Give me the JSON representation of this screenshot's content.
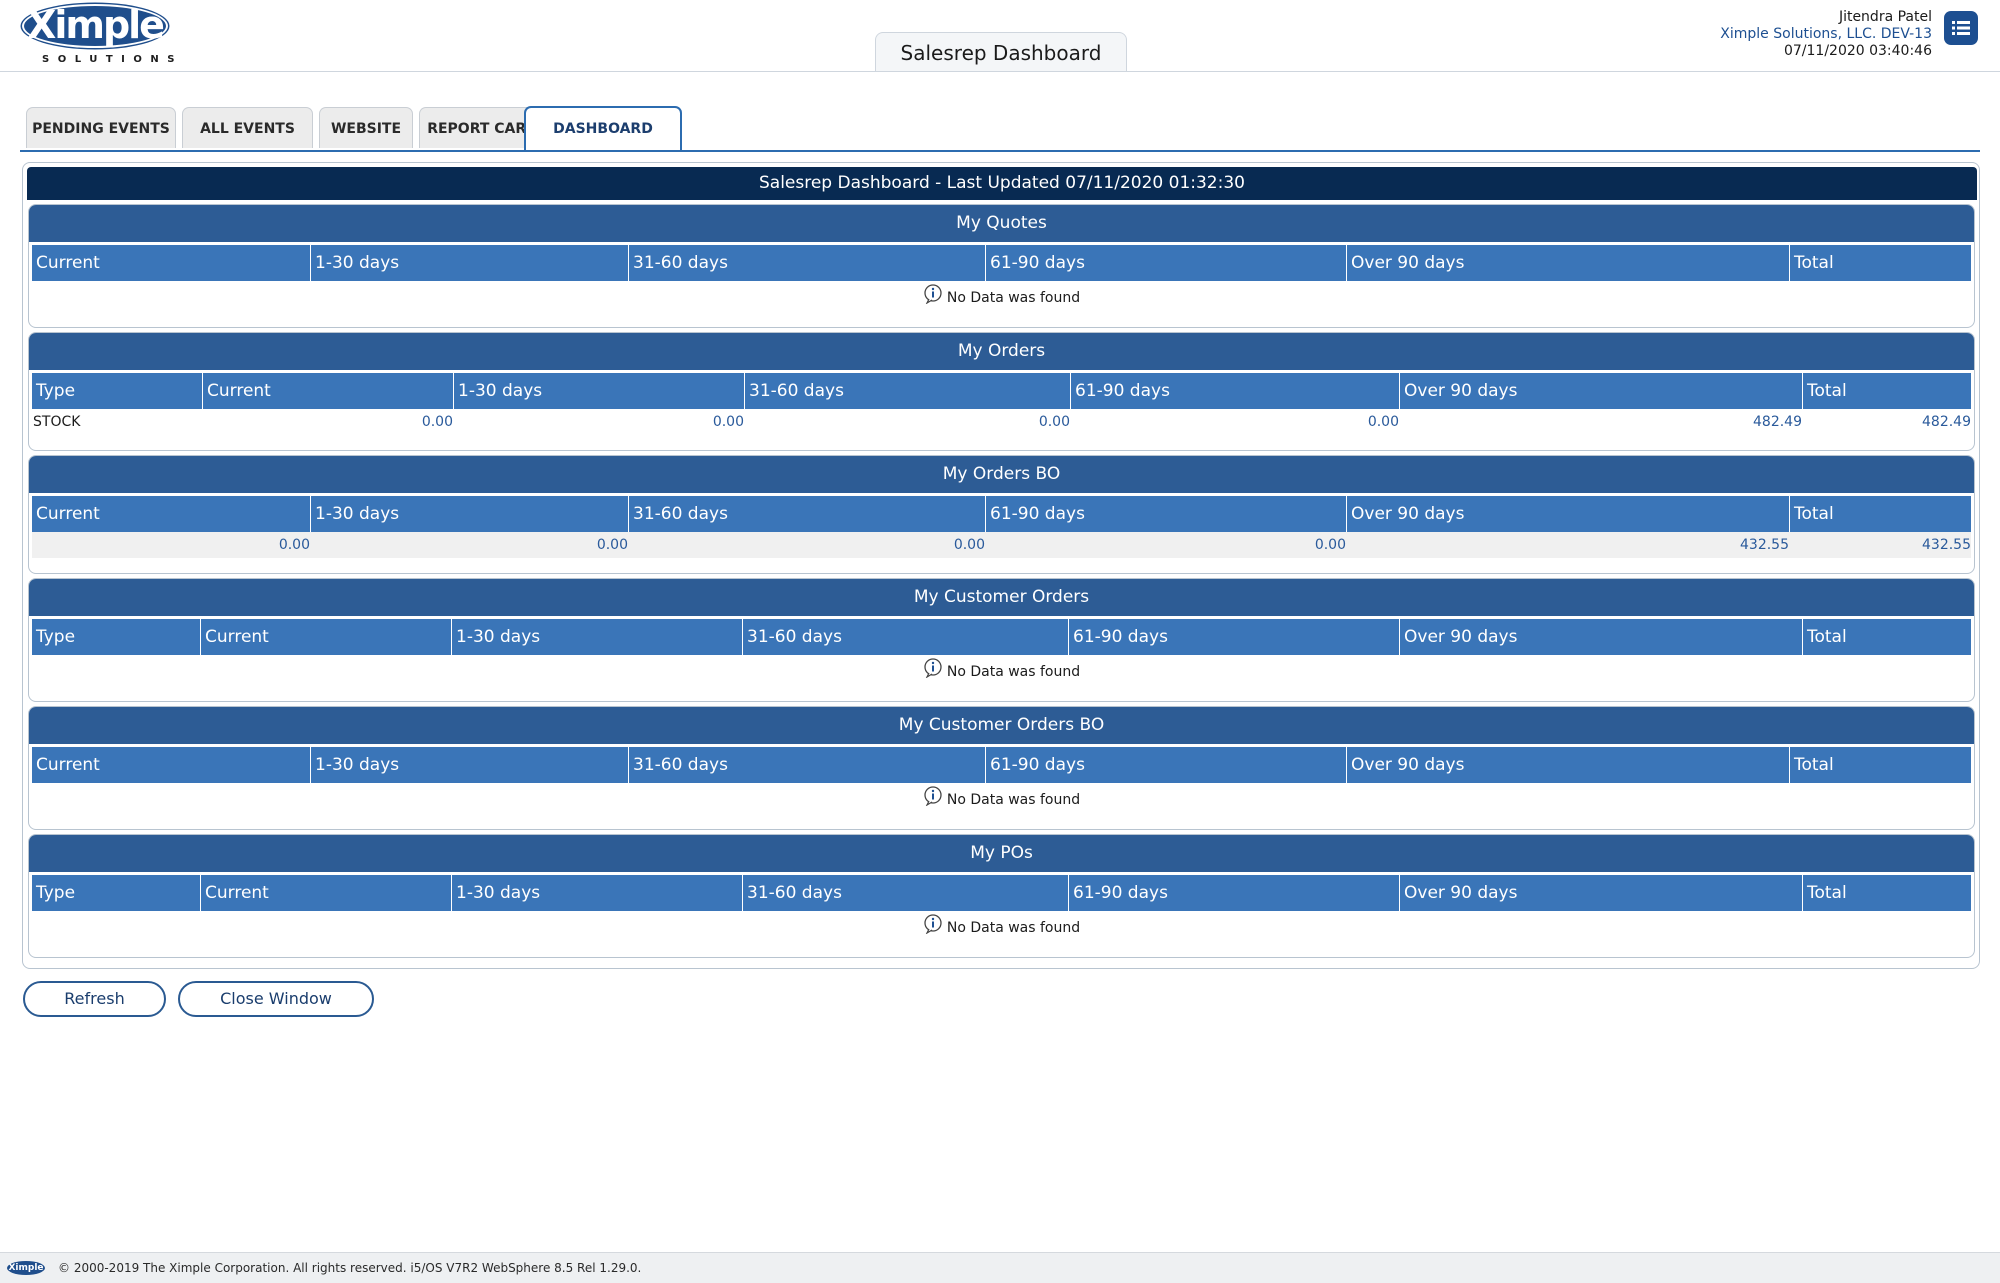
{
  "header": {
    "logo_text": "Ximple",
    "logo_subtext": "SOLUTIONS",
    "page_title": "Salesrep Dashboard",
    "user_name": "Jitendra Patel",
    "company": "Ximple Solutions, LLC. DEV-13",
    "datetime": "07/11/2020 03:40:46",
    "menu_icon": "list-menu-icon"
  },
  "tabs": [
    {
      "label": "PENDING EVENTS",
      "active": false
    },
    {
      "label": "ALL EVENTS",
      "active": false
    },
    {
      "label": "WEBSITE",
      "active": false
    },
    {
      "label": "REPORT CARD",
      "active": false
    },
    {
      "label": "DASHBOARD",
      "active": true
    }
  ],
  "dashboard_title": "Salesrep Dashboard - Last Updated 07/11/2020 01:32:30",
  "no_data_text": "No Data was found",
  "sections": {
    "quotes": {
      "title": "My Quotes",
      "columns": [
        "Current",
        "1-30 days",
        "31-60 days",
        "61-90 days",
        "Over 90 days",
        "Total"
      ]
    },
    "orders": {
      "title": "My Orders",
      "columns": [
        "Type",
        "Current",
        "1-30 days",
        "31-60 days",
        "61-90 days",
        "Over 90 days",
        "Total"
      ],
      "rows": [
        [
          "STOCK",
          "0.00",
          "0.00",
          "0.00",
          "0.00",
          "482.49",
          "482.49"
        ]
      ]
    },
    "orders_bo": {
      "title": "My Orders BO",
      "columns": [
        "Current",
        "1-30 days",
        "31-60 days",
        "61-90 days",
        "Over 90 days",
        "Total"
      ],
      "rows": [
        [
          "0.00",
          "0.00",
          "0.00",
          "0.00",
          "432.55",
          "432.55"
        ]
      ]
    },
    "customer_orders": {
      "title": "My Customer Orders",
      "columns": [
        "Type",
        "Current",
        "1-30 days",
        "31-60 days",
        "61-90 days",
        "Over 90 days",
        "Total"
      ]
    },
    "customer_orders_bo": {
      "title": "My Customer Orders BO",
      "columns": [
        "Current",
        "1-30 days",
        "31-60 days",
        "61-90 days",
        "Over 90 days",
        "Total"
      ]
    },
    "pos": {
      "title": "My POs",
      "columns": [
        "Type",
        "Current",
        "1-30 days",
        "31-60 days",
        "61-90 days",
        "Over 90 days",
        "Total"
      ]
    }
  },
  "buttons": {
    "refresh": "Refresh",
    "close": "Close Window"
  },
  "footer": {
    "logo_text": "Ximple",
    "text": "© 2000-2019 The Ximple Corporation. All rights reserved. i5/OS V7R2 WebSphere 8.5 Rel 1.29.0."
  },
  "colors": {
    "primary_dark": "#082a52",
    "section_header": "#2d5c95",
    "table_header": "#3a75b8",
    "link_value": "#2a5a9b",
    "accent_border": "#2c6cb0"
  }
}
